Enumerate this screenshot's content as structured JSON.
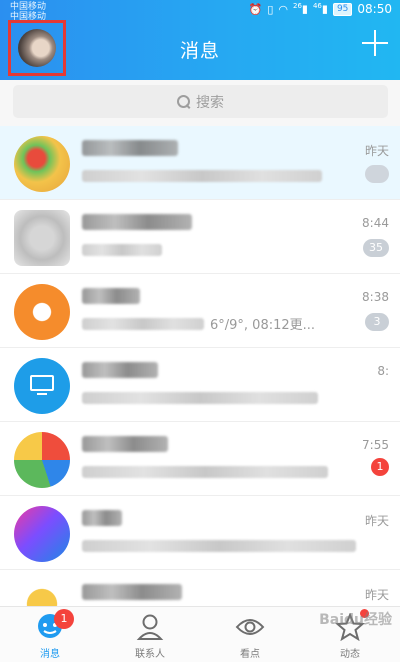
{
  "status_bar": {
    "carrier_1": "中国移动",
    "carrier_2": "中国移动",
    "signal_1": "26",
    "signal_2": "46",
    "battery": "95",
    "time": "08:50"
  },
  "header": {
    "title": "消息",
    "plus_icon": "plus-icon",
    "accent_color": "#2b8ff0"
  },
  "search": {
    "placeholder": "搜索",
    "icon": "search-icon"
  },
  "conversations": [
    {
      "time": "昨天",
      "badge": "",
      "preview": "",
      "avatar_color": "#e8a93b"
    },
    {
      "time": "8:44",
      "badge": "35",
      "preview": "",
      "avatar_color": "#bdbdbd"
    },
    {
      "time": "8:38",
      "badge": "3",
      "preview": "6°/9°, 08:12更...",
      "avatar_color": "#f58c2c"
    },
    {
      "time": "8:",
      "badge": "",
      "preview": "",
      "avatar_color": "#1e9de8"
    },
    {
      "time": "7:55",
      "badge": "1",
      "preview": "",
      "avatar_color": "#4caf50"
    },
    {
      "time": "昨天",
      "badge": "",
      "preview": "",
      "avatar_color": "#7c4dff"
    },
    {
      "time": "昨天",
      "badge": "",
      "preview": "",
      "avatar_color": "#f7c948"
    }
  ],
  "bottom_nav": {
    "items": [
      {
        "label": "消息",
        "icon": "chat-bubble-icon",
        "badge": "1"
      },
      {
        "label": "联系人",
        "icon": "contact-person-icon",
        "badge": ""
      },
      {
        "label": "看点",
        "icon": "eye-icon",
        "badge": ""
      },
      {
        "label": "动态",
        "icon": "star-icon",
        "dot": true
      }
    ]
  },
  "watermark": "Baidu经验"
}
